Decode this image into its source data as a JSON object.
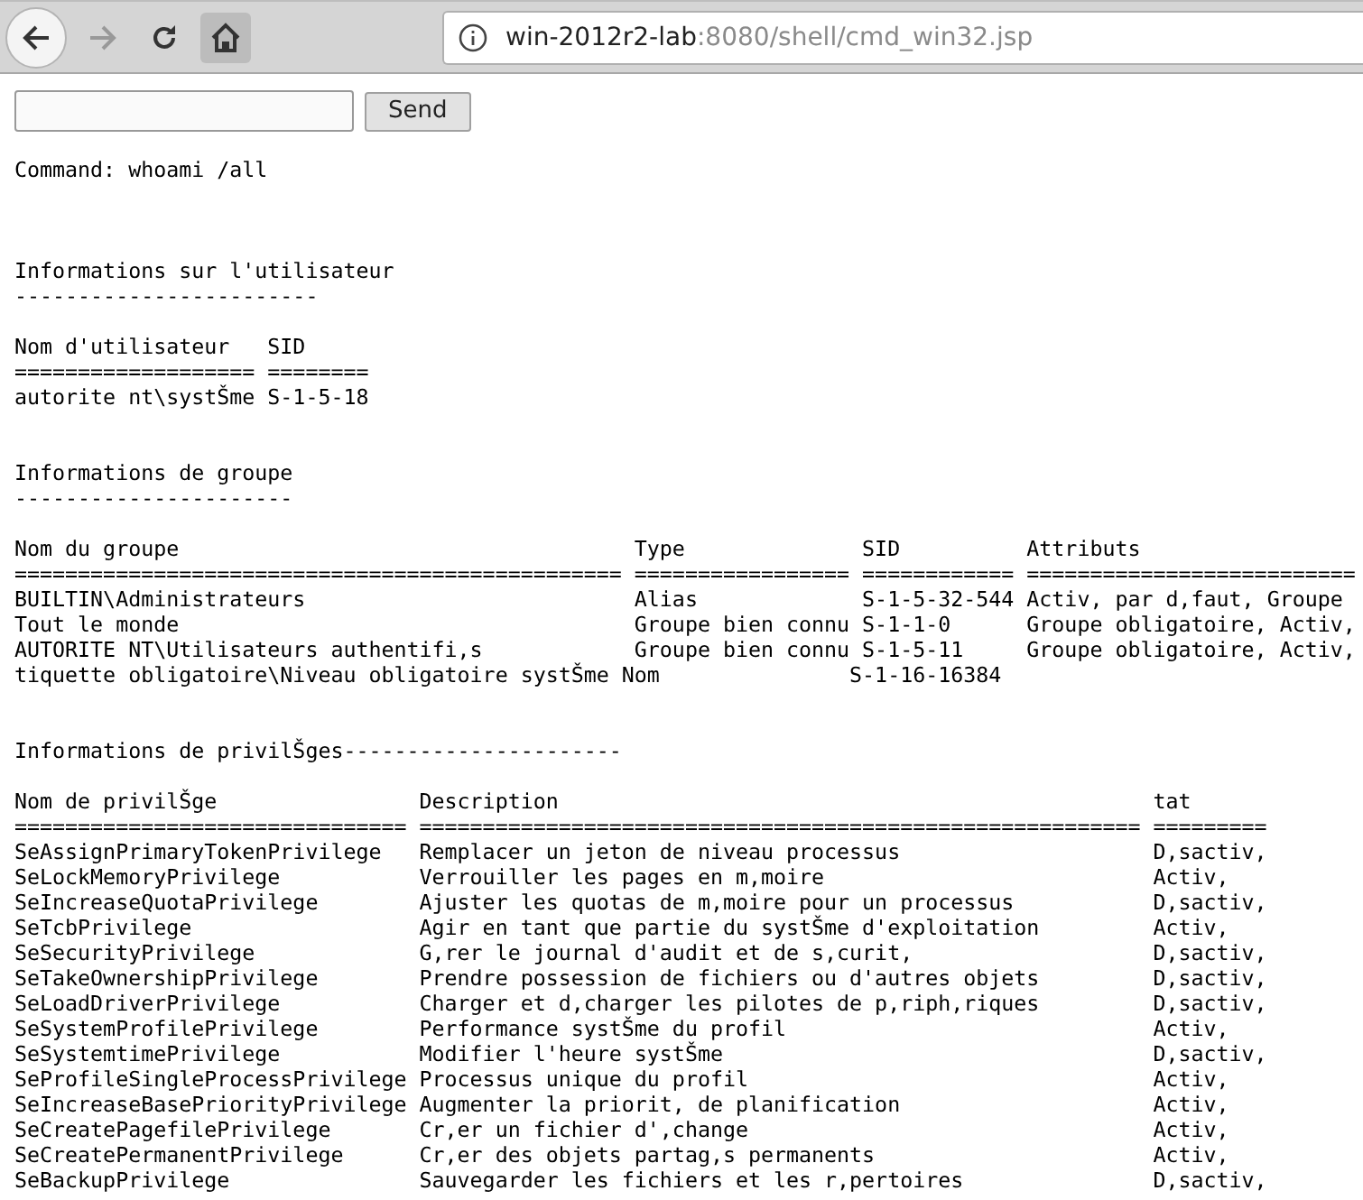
{
  "browser": {
    "url_host": "win-2012r2-lab",
    "url_rest": ":8080/shell/cmd_win32.jsp"
  },
  "form": {
    "button": "Send"
  },
  "output": [
    {
      "kind": "text",
      "text": "Command: whoami /all"
    },
    {
      "kind": "blank"
    },
    {
      "kind": "blank"
    },
    {
      "kind": "blank"
    },
    {
      "kind": "text",
      "text": "Informations sur l'utilisateur"
    },
    {
      "kind": "text",
      "text": "------------------------"
    },
    {
      "kind": "blank"
    },
    {
      "kind": "text",
      "text": "Nom d'utilisateur   SID"
    },
    {
      "kind": "text",
      "text": "=================== ========"
    },
    {
      "kind": "text",
      "text": "autorite nt\\systŠme S-1-5-18"
    },
    {
      "kind": "blank"
    },
    {
      "kind": "blank"
    },
    {
      "kind": "text",
      "text": "Informations de groupe"
    },
    {
      "kind": "text",
      "text": "----------------------"
    },
    {
      "kind": "blank"
    },
    {
      "kind": "text",
      "text": "Nom du groupe                                    Type              SID          Attributs"
    },
    {
      "kind": "text",
      "text": "================================================ ================= ============ =========================="
    },
    {
      "kind": "text",
      "text": "BUILTIN\\Administrateurs                          Alias             S-1-5-32-544 Activ, par d,faut, Groupe"
    },
    {
      "kind": "text",
      "text": "Tout le monde                                    Groupe bien connu S-1-1-0      Groupe obligatoire, Activ,"
    },
    {
      "kind": "text",
      "text": "AUTORITE NT\\Utilisateurs authentifi,s            Groupe bien connu S-1-5-11     Groupe obligatoire, Activ,"
    },
    {
      "kind": "text",
      "text": "tiquette obligatoire\\Niveau obligatoire systŠme Nom               S-1-16-16384"
    },
    {
      "kind": "blank"
    },
    {
      "kind": "blank"
    },
    {
      "kind": "text",
      "text": "Informations de privilŠges----------------------"
    },
    {
      "kind": "blank"
    },
    {
      "kind": "text",
      "text": "Nom de privilŠge                Description                                               tat"
    },
    {
      "kind": "text",
      "text": "=============================== ========================================================= ========="
    },
    {
      "kind": "text",
      "text": "SeAssignPrimaryTokenPrivilege   Remplacer un jeton de niveau processus                    D,sactiv,"
    },
    {
      "kind": "text",
      "text": "SeLockMemoryPrivilege           Verrouiller les pages en m,moire                          Activ,"
    },
    {
      "kind": "text",
      "text": "SeIncreaseQuotaPrivilege        Ajuster les quotas de m,moire pour un processus           D,sactiv,"
    },
    {
      "kind": "text",
      "text": "SeTcbPrivilege                  Agir en tant que partie du systŠme d'exploitation         Activ,"
    },
    {
      "kind": "text",
      "text": "SeSecurityPrivilege             G,rer le journal d'audit et de s,curit,                   D,sactiv,"
    },
    {
      "kind": "text",
      "text": "SeTakeOwnershipPrivilege        Prendre possession de fichiers ou d'autres objets         D,sactiv,"
    },
    {
      "kind": "text",
      "text": "SeLoadDriverPrivilege           Charger et d,charger les pilotes de p,riph,riques         D,sactiv,"
    },
    {
      "kind": "text",
      "text": "SeSystemProfilePrivilege        Performance systŠme du profil                             Activ,"
    },
    {
      "kind": "text",
      "text": "SeSystemtimePrivilege           Modifier l'heure systŠme                                  D,sactiv,"
    },
    {
      "kind": "text",
      "text": "SeProfileSingleProcessPrivilege Processus unique du profil                                Activ,"
    },
    {
      "kind": "text",
      "text": "SeIncreaseBasePriorityPrivilege Augmenter la priorit, de planification                    Activ,"
    },
    {
      "kind": "text",
      "text": "SeCreatePagefilePrivilege       Cr,er un fichier d',change                                Activ,"
    },
    {
      "kind": "text",
      "text": "SeCreatePermanentPrivilege      Cr,er des objets partag,s permanents                      Activ,"
    },
    {
      "kind": "text",
      "text": "SeBackupPrivilege               Sauvegarder les fichiers et les r,pertoires               D,sactiv,"
    }
  ]
}
